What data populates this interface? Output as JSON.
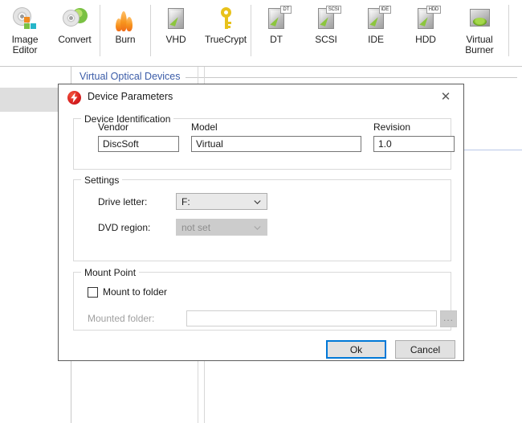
{
  "toolbar": {
    "groups": [
      {
        "items": [
          {
            "label": "Image\nEditor",
            "label_line1": "Image",
            "label_line2": "Editor",
            "icon": "disc-edit-icon"
          },
          {
            "label": "Convert",
            "icon": "disc-convert-icon"
          }
        ]
      },
      {
        "items": [
          {
            "label": "Burn",
            "icon": "flame-icon"
          }
        ]
      },
      {
        "items": [
          {
            "label": "VHD",
            "icon": "hard-disk-icon"
          },
          {
            "label": "TrueCrypt",
            "icon": "key-icon"
          }
        ]
      },
      {
        "items": [
          {
            "label": "DT",
            "icon": "hard-disk-icon",
            "badge": "DT"
          },
          {
            "label": "SCSI",
            "icon": "hard-disk-icon",
            "badge": "SCSI"
          },
          {
            "label": "IDE",
            "icon": "hard-disk-icon",
            "badge": "IDE"
          },
          {
            "label": "HDD",
            "icon": "hard-disk-icon",
            "badge": "HDD"
          },
          {
            "label_line1": "Virtual",
            "label_line2": "Burner",
            "icon": "virtual-burner-icon"
          }
        ]
      }
    ]
  },
  "background": {
    "section_header": "Virtual Optical Devices"
  },
  "dialog": {
    "title": "Device Parameters",
    "logo_icon": "daemon-tools-bolt-icon",
    "close_icon": "close-icon",
    "close_glyph": "✕",
    "accent_color": "#0078d7",
    "logo_color": "#d81f1f",
    "header_link_color": "#3b5ca8",
    "groups": {
      "device_identification": {
        "title": "Device Identification",
        "vendor": {
          "label": "Vendor",
          "value": "DiscSoft",
          "placeholder": ""
        },
        "model": {
          "label": "Model",
          "value": "Virtual",
          "placeholder": ""
        },
        "revision": {
          "label": "Revision",
          "value": "1.0",
          "placeholder": ""
        }
      },
      "settings": {
        "title": "Settings",
        "drive_letter": {
          "label": "Drive letter:",
          "value": "F:",
          "enabled": true,
          "chevron_icon": "chevron-down-icon"
        },
        "dvd_region": {
          "label": "DVD region:",
          "value": "not set",
          "enabled": false,
          "chevron_icon": "chevron-down-icon"
        }
      },
      "mount_point": {
        "title": "Mount Point",
        "mount_to_folder": {
          "label": "Mount to folder",
          "checked": false
        },
        "mounted_folder": {
          "label": "Mounted folder:",
          "value": "",
          "placeholder": "",
          "enabled": false
        },
        "browse_button": {
          "label": "...",
          "enabled": false
        }
      }
    },
    "buttons": {
      "ok": {
        "label": "Ok",
        "is_default": true
      },
      "cancel": {
        "label": "Cancel",
        "is_default": false
      }
    }
  }
}
